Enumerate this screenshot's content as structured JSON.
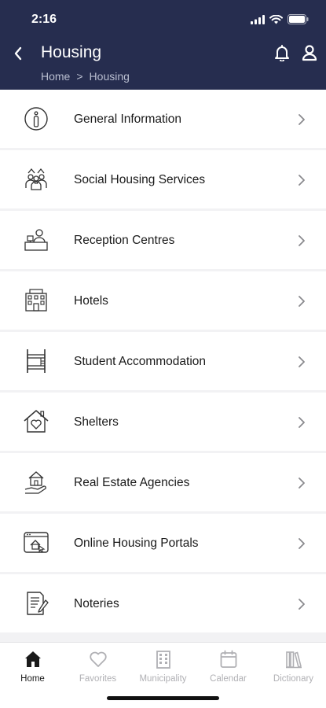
{
  "status_bar": {
    "time": "2:16"
  },
  "header": {
    "title": "Housing",
    "breadcrumb": [
      "Home",
      ">",
      "Housing"
    ]
  },
  "list": {
    "items": [
      {
        "label": "General Information",
        "icon": "info-icon"
      },
      {
        "label": "Social Housing Services",
        "icon": "people-group-icon"
      },
      {
        "label": "Reception Centres",
        "icon": "reception-desk-icon"
      },
      {
        "label": "Hotels",
        "icon": "hotel-icon"
      },
      {
        "label": "Student Accommodation",
        "icon": "bunk-bed-icon"
      },
      {
        "label": "Shelters",
        "icon": "house-heart-icon"
      },
      {
        "label": "Real Estate Agencies",
        "icon": "house-hand-icon"
      },
      {
        "label": "Online Housing Portals",
        "icon": "web-browser-icon"
      },
      {
        "label": "Noteries",
        "icon": "document-pen-icon"
      }
    ]
  },
  "tabbar": {
    "tabs": [
      {
        "label": "Home",
        "icon": "home-icon",
        "active": true
      },
      {
        "label": "Favorites",
        "icon": "heart-icon",
        "active": false
      },
      {
        "label": "Municipality",
        "icon": "building-icon",
        "active": false
      },
      {
        "label": "Calendar",
        "icon": "calendar-icon",
        "active": false
      },
      {
        "label": "Dictionary",
        "icon": "books-icon",
        "active": false
      }
    ]
  },
  "colors": {
    "header_bg": "#262d4f",
    "active_tab": "#1a1a1a",
    "inactive_tab": "#b0b0b4"
  }
}
